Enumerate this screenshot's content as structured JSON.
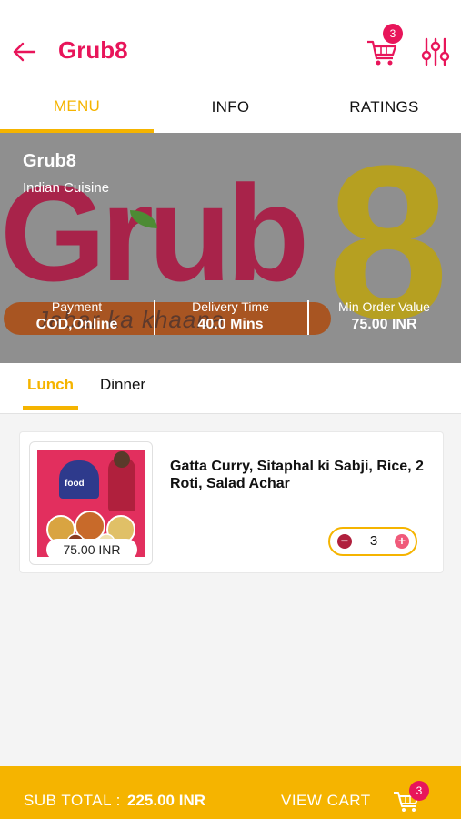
{
  "header": {
    "back_icon": "arrow-left-icon",
    "title": "Grub8",
    "cart_icon": "cart-icon",
    "cart_count": "3",
    "filter_icon": "sliders-icon",
    "accent_color": "#e8155a"
  },
  "tabs": [
    {
      "label": "MENU",
      "active": true
    },
    {
      "label": "INFO",
      "active": false
    },
    {
      "label": "RATINGS",
      "active": false
    }
  ],
  "banner": {
    "title": "Grub8",
    "subtitle": "Indian Cuisine",
    "logo_text": "Grub",
    "logo_numeral": "8",
    "tagline": "Jabar ka khaana",
    "stats": [
      {
        "label": "Payment",
        "value": "COD,Online"
      },
      {
        "label": "Delivery Time",
        "value": "40.0 Mins"
      },
      {
        "label": "Min Order Value",
        "value": "75.00 INR"
      }
    ]
  },
  "meal_tabs": [
    {
      "label": "Lunch",
      "active": true
    },
    {
      "label": "Dinner",
      "active": false
    }
  ],
  "items": [
    {
      "title": "Gatta Curry, Sitaphal ki Sabji, Rice, 2 Roti, Salad Achar",
      "price": "75.00 INR",
      "quantity": "3",
      "thumb_text": "food",
      "minus_label": "−",
      "plus_label": "+"
    }
  ],
  "footer": {
    "subtotal_label": "SUB TOTAL :",
    "subtotal_value": "225.00 INR",
    "view_cart_label": "VIEW CART",
    "cart_count": "3",
    "accent_color": "#f5b400"
  }
}
